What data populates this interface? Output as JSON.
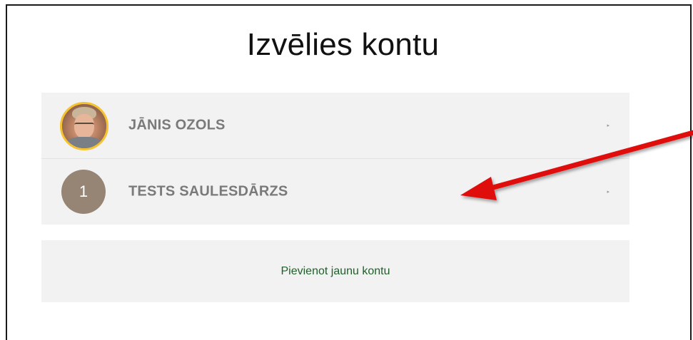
{
  "page": {
    "title": "Izvēlies kontu"
  },
  "accounts": [
    {
      "name": "JĀNIS OZOLS",
      "avatar": "profile-photo",
      "avatar_border_color": "#f5c230"
    },
    {
      "name": "TESTS SAULESDĀRZS",
      "avatar_letter": "1",
      "avatar_color": "#968474"
    }
  ],
  "chevron_icon": "▸",
  "add_account": {
    "label": "Pievienot jaunu kontu",
    "color": "#1f5f2a"
  },
  "annotation": {
    "type": "arrow",
    "color": "#e01010",
    "points_to": "TESTS SAULESDĀRZS"
  }
}
